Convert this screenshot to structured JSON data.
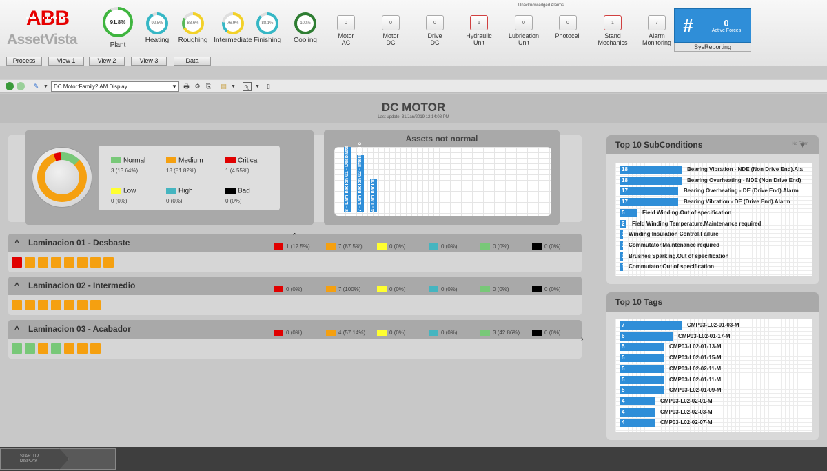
{
  "app": {
    "brand": "ABB",
    "product": "AssetVista"
  },
  "header": {
    "gauges": [
      {
        "label": "Plant",
        "value": "91.8%",
        "percent": 91.8
      },
      {
        "label": "Heating",
        "value": "92.5%",
        "percent": 92.5
      },
      {
        "label": "Roughing",
        "value": "83.6%",
        "percent": 83.6
      },
      {
        "label": "Intermediate",
        "value": "76.9%",
        "percent": 76.9
      },
      {
        "label": "Finishing",
        "value": "88.1%",
        "percent": 88.1
      },
      {
        "label": "Cooling",
        "value": "100%",
        "percent": 100
      }
    ],
    "unacknowledged_alarms_caption": "Unacknowledged Alarms",
    "alarms": [
      {
        "label1": "Motor",
        "label2": "AC",
        "count": "0",
        "alert": false
      },
      {
        "label1": "Motor",
        "label2": "DC",
        "count": "0",
        "alert": false
      },
      {
        "label1": "Drive",
        "label2": "DC",
        "count": "0",
        "alert": false
      },
      {
        "label1": "Hydraulic",
        "label2": "Unit",
        "count": "1",
        "alert": true
      },
      {
        "label1": "Lubrication",
        "label2": "Unit",
        "count": "0",
        "alert": false
      },
      {
        "label1": "Photocell",
        "label2": "",
        "count": "0",
        "alert": false
      },
      {
        "label1": "Stand",
        "label2": "Mechanics",
        "count": "1",
        "alert": true
      },
      {
        "label1": "Alarm",
        "label2": "Monitoring",
        "count": "7",
        "alert": false
      }
    ],
    "sysreporting": {
      "symbol": "#",
      "count": "0",
      "count_label": "Active Forces",
      "label": "SysReporting"
    },
    "nav_tabs": [
      "Process",
      "View 1",
      "View 2",
      "View 3",
      "Data"
    ]
  },
  "toolbar": {
    "view_selector": "DC Motor:Family2 AM Display"
  },
  "page": {
    "title": "DC MOTOR",
    "last_update": "Last update: 31/Jan/2019 12:14:08 PM"
  },
  "summary": {
    "legend": [
      {
        "name": "Normal",
        "value": "3 (13.64%)",
        "color": "#78c878"
      },
      {
        "name": "Medium",
        "value": "18 (81.82%)",
        "color": "#f5a010"
      },
      {
        "name": "Critical",
        "value": "1 (4.55%)",
        "color": "#e00000"
      },
      {
        "name": "Low",
        "value": "0 (0%)",
        "color": "#ffff30"
      },
      {
        "name": "High",
        "value": "0 (0%)",
        "color": "#45b5c0"
      },
      {
        "name": "Bad",
        "value": "0 (0%)",
        "color": "#000000"
      }
    ],
    "donut_shares": {
      "normal": 13.64,
      "medium": 81.82,
      "critical": 4.55
    }
  },
  "assets_not_normal": {
    "title": "Assets not normal",
    "bars": [
      {
        "label": "8 - Laminacion 01 - Desbaste",
        "count": 8
      },
      {
        "label": "7 - Laminacion 02 - Intermedio",
        "count": 7
      },
      {
        "label": "4 - Laminacion 03 - Acabador",
        "count": 4
      }
    ]
  },
  "sections": [
    {
      "name": "Laminacion 01 - Desbaste",
      "stats": [
        "1 (12.5%)",
        "7 (87.5%)",
        "0 (0%)",
        "0 (0%)",
        "0 (0%)",
        "0 (0%)"
      ],
      "assets": [
        "critical",
        "medium",
        "medium",
        "medium",
        "medium",
        "medium",
        "medium",
        "medium"
      ]
    },
    {
      "name": "Laminacion 02 - Intermedio",
      "stats": [
        "0 (0%)",
        "7 (100%)",
        "0 (0%)",
        "0 (0%)",
        "0 (0%)",
        "0 (0%)"
      ],
      "assets": [
        "medium",
        "medium",
        "medium",
        "medium",
        "medium",
        "medium",
        "medium"
      ]
    },
    {
      "name": "Laminacion 03 - Acabador",
      "stats": [
        "0 (0%)",
        "4 (57.14%)",
        "0 (0%)",
        "0 (0%)",
        "3 (42.86%)",
        "0 (0%)"
      ],
      "assets": [
        "normal",
        "normal",
        "medium",
        "normal",
        "medium",
        "medium",
        "medium"
      ]
    }
  ],
  "stat_colors": [
    "#e00000",
    "#f5a010",
    "#ffff30",
    "#45b5c0",
    "#78c878",
    "#000000"
  ],
  "status_colors": {
    "critical": "#e00000",
    "medium": "#f5a010",
    "normal": "#78c878"
  },
  "top_subconditions": {
    "title": "Top 10 SubConditions",
    "filter_label": "No Filter",
    "items": [
      {
        "count": "18",
        "text": "Bearing Vibration - NDE (Non Drive End).Ala"
      },
      {
        "count": "18",
        "text": "Bearing Overheating - NDE (Non Drive End)."
      },
      {
        "count": "17",
        "text": "Bearing Overheating - DE (Drive End).Alarm"
      },
      {
        "count": "17",
        "text": "Bearing Vibration - DE (Drive End).Alarm"
      },
      {
        "count": "5",
        "text": "Field Winding.Out of specification"
      },
      {
        "count": "2",
        "text": "Field Winding Temperature.Maintenance required"
      },
      {
        "count": "1",
        "text": "Winding Insulation Control.Failure"
      },
      {
        "count": "1",
        "text": "Commutator.Maintenance required"
      },
      {
        "count": "1",
        "text": "Brushes Sparking.Out of specification"
      },
      {
        "count": "1",
        "text": "Commutator.Out of specification"
      }
    ]
  },
  "top_tags": {
    "title": "Top 10 Tags",
    "items": [
      {
        "count": "7",
        "text": "CMP03-L02-01-03-M"
      },
      {
        "count": "6",
        "text": "CMP03-L02-01-17-M"
      },
      {
        "count": "5",
        "text": "CMP03-L02-01-13-M"
      },
      {
        "count": "5",
        "text": "CMP03-L02-01-15-M"
      },
      {
        "count": "5",
        "text": "CMP03-L02-02-11-M"
      },
      {
        "count": "5",
        "text": "CMP03-L02-01-11-M"
      },
      {
        "count": "5",
        "text": "CMP03-L02-01-09-M"
      },
      {
        "count": "4",
        "text": "CMP03-L02-02-01-M"
      },
      {
        "count": "4",
        "text": "CMP03-L02-02-03-M"
      },
      {
        "count": "4",
        "text": "CMP03-L02-02-07-M"
      }
    ]
  },
  "footer": {
    "startup_line1": "STARTUP",
    "startup_line2": "DISPLAY"
  }
}
